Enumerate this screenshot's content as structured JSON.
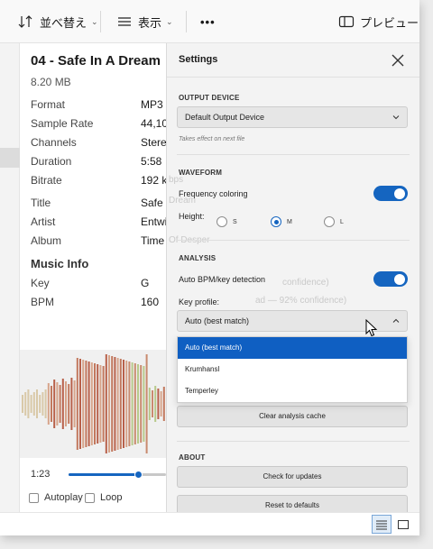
{
  "toolbar": {
    "sort_label": "並べ替え",
    "view_label": "表示",
    "more_label": "•••",
    "preview_label": "プレビュー"
  },
  "details": {
    "title": "04 - Safe In A Dream",
    "size": "8.20 MB",
    "rows": [
      {
        "label": "Format",
        "value": "MP3"
      },
      {
        "label": "Sample Rate",
        "value": "44,10"
      },
      {
        "label": "Channels",
        "value": "Stere"
      },
      {
        "label": "Duration",
        "value": "5:58"
      },
      {
        "label": "Bitrate",
        "value": "192 k"
      },
      {
        "label": "Title",
        "value": "Safe I"
      },
      {
        "label": "Artist",
        "value": "Entwi"
      },
      {
        "label": "Album",
        "value": "Time"
      }
    ],
    "music_info_heading": "Music Info",
    "music_rows": [
      {
        "label": "Key",
        "value": "G"
      },
      {
        "label": "BPM",
        "value": "160"
      }
    ],
    "playback": {
      "time": "1:23",
      "progress": 0.72
    },
    "autoplay_label": "Autoplay",
    "loop_label": "Loop"
  },
  "settings": {
    "title": "Settings",
    "output_device": {
      "section": "OUTPUT DEVICE",
      "selected": "Default Output Device",
      "hint": "Takes effect on next file"
    },
    "waveform": {
      "section": "WAVEFORM",
      "frequency_coloring_label": "Frequency coloring",
      "frequency_coloring_on": true,
      "height_label": "Height:",
      "height_options": [
        "S",
        "M",
        "L"
      ],
      "height_selected": "M"
    },
    "analysis": {
      "section": "ANALYSIS",
      "auto_bpm_label": "Auto BPM/key detection",
      "auto_bpm_on": true,
      "key_profile_label": "Key profile:",
      "key_profile_selected": "Auto (best match)",
      "key_profile_options": [
        "Auto (best match)",
        "Krumhansl",
        "Temperley"
      ],
      "clear_cache_label": "Clear analysis cache"
    },
    "about": {
      "section": "ABOUT",
      "check_updates_label": "Check for updates",
      "reset_label": "Reset to defaults"
    },
    "background_ghost": {
      "album_tail": "Of Desper",
      "title_tail": "Dream",
      "bitrate_tail": "bps",
      "confidence1": "confidence)",
      "confidence2": "ad — 92% confidence)"
    }
  },
  "colors": {
    "accent": "#1565c0",
    "dropdown_highlight": "#0f5fc2",
    "panel_bg": "#f3f3f3"
  },
  "statusbar": {
    "details_view_icon": "list-view-icon",
    "tiles_view_icon": "tiles-view-icon"
  }
}
